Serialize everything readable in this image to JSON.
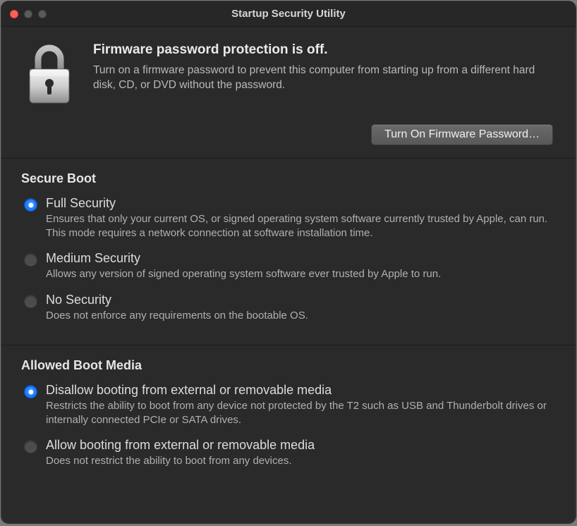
{
  "window": {
    "title": "Startup Security Utility"
  },
  "firmware": {
    "heading": "Firmware password protection is off.",
    "description": "Turn on a firmware password to prevent this computer from starting up from a different hard disk, CD, or DVD without the password.",
    "button_label": "Turn On Firmware Password…"
  },
  "secure_boot": {
    "heading": "Secure Boot",
    "options": [
      {
        "label": "Full Security",
        "desc": "Ensures that only your current OS, or signed operating system software currently trusted by Apple, can run. This mode requires a network connection at software installation time.",
        "selected": true
      },
      {
        "label": "Medium Security",
        "desc": "Allows any version of signed operating system software ever trusted by Apple to run.",
        "selected": false
      },
      {
        "label": "No Security",
        "desc": "Does not enforce any requirements on the bootable OS.",
        "selected": false
      }
    ]
  },
  "boot_media": {
    "heading": "Allowed Boot Media",
    "options": [
      {
        "label": "Disallow booting from external or removable media",
        "desc": "Restricts the ability to boot from any device not protected by the T2 such as USB and Thunderbolt drives or internally connected PCIe or SATA drives.",
        "selected": true
      },
      {
        "label": "Allow booting from external or removable media",
        "desc": "Does not restrict the ability to boot from any devices.",
        "selected": false
      }
    ]
  }
}
